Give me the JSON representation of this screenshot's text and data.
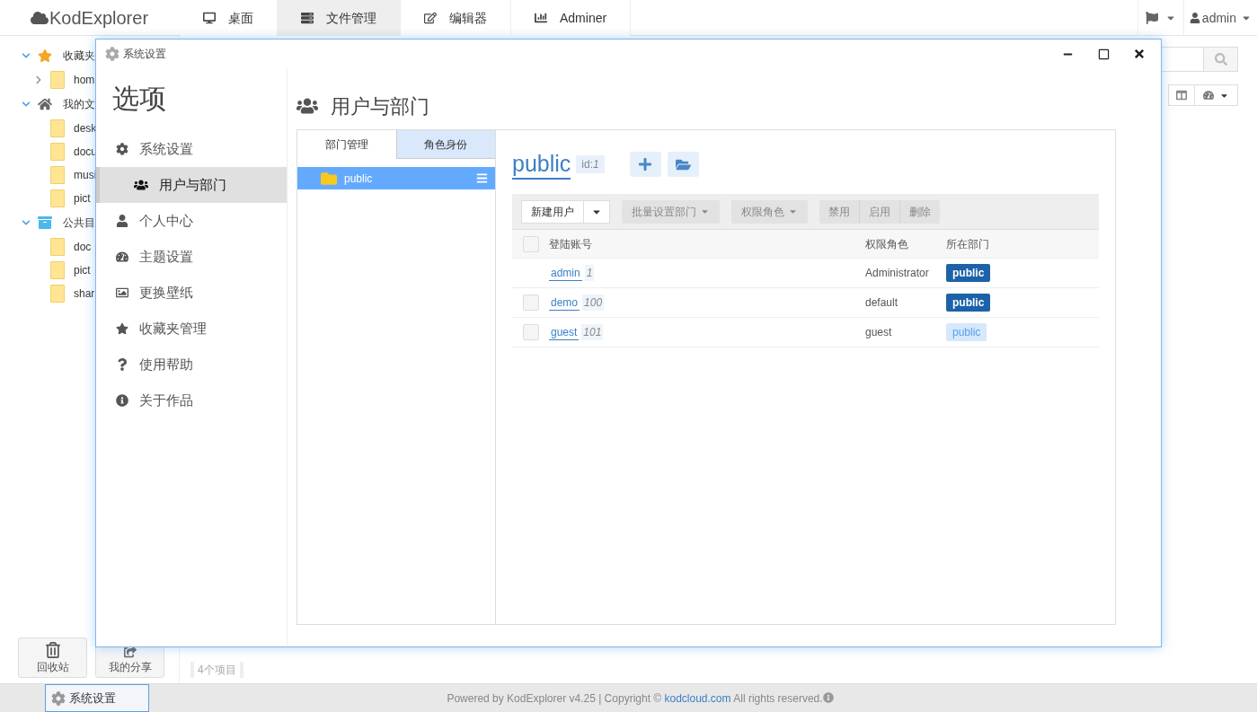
{
  "app": {
    "logo": "KodExplorer"
  },
  "nav_tabs": [
    {
      "label": "桌面",
      "selected": false
    },
    {
      "label": "文件管理",
      "selected": true
    },
    {
      "label": "编辑器",
      "selected": false
    },
    {
      "label": "Adminer",
      "selected": false
    }
  ],
  "user_menu": {
    "label": "admin"
  },
  "tree": [
    {
      "label": "收藏夹",
      "expanded": true,
      "children": [
        {
          "label": "hom",
          "expandable": true
        }
      ]
    },
    {
      "label": "我的文",
      "expanded": true,
      "children": [
        {
          "label": "desk",
          "expandable": false
        },
        {
          "label": "docu",
          "expandable": false
        },
        {
          "label": "musi",
          "expandable": false
        },
        {
          "label": "pict",
          "expandable": false
        }
      ]
    },
    {
      "label": "公共目",
      "expanded": true,
      "children": [
        {
          "label": "doc",
          "expandable": false
        },
        {
          "label": "pict",
          "expandable": false
        },
        {
          "label": "shar",
          "expandable": false
        }
      ]
    }
  ],
  "bottom_buttons": [
    {
      "label": "回收站"
    },
    {
      "label": "我的分享"
    }
  ],
  "status": {
    "count": "4个项目"
  },
  "footer": {
    "taskbar": [
      {
        "label": "系统设置",
        "selected": true
      }
    ],
    "credit": "Powered by KodExplorer v4.25 | Copyright © ",
    "link": "kodcloud.com",
    "suffix": " All rights reserved."
  },
  "dialog": {
    "title": "系统设置",
    "sidebar": {
      "heading": "选项",
      "items": [
        {
          "label": "系统设置",
          "selected": false,
          "children": [
            {
              "label": "用户与部门",
              "selected": true
            }
          ]
        },
        {
          "label": "个人中心",
          "selected": false
        },
        {
          "label": "主题设置",
          "selected": false
        },
        {
          "label": "更换壁纸",
          "selected": false
        },
        {
          "label": "收藏夹管理",
          "selected": false
        },
        {
          "label": "使用帮助",
          "selected": false
        },
        {
          "label": "关于作品",
          "selected": false
        }
      ]
    },
    "page_title": "用户与部门",
    "tabs": [
      {
        "label": "部门管理",
        "selected": true
      },
      {
        "label": "角色身份",
        "selected": false
      }
    ],
    "departments": [
      {
        "label": "public",
        "selected": true
      }
    ],
    "group": {
      "name": "public",
      "id": "id:*1*"
    },
    "toolbar": {
      "new_user": "新建用户",
      "dropdowns": [
        "批量设置部门",
        "权限角色"
      ],
      "actions": [
        "禁用",
        "启用",
        "删除"
      ]
    },
    "table": {
      "header_checked": false,
      "columns": [
        "登陆账号",
        "权限角色",
        "所在部门"
      ],
      "rows": [
        {
          "account": "admin",
          "uid": "1",
          "role": "Administrator",
          "department": "public",
          "color": "#1d62a8"
        },
        {
          "account": "demo",
          "uid": "100",
          "role": "default",
          "department": "public",
          "color": "#1d62a8",
          "checked": false
        },
        {
          "account": "guest",
          "uid": "101",
          "role": "guest",
          "department": "public",
          "color": "#d5e8fc",
          "checked": false
        }
      ]
    }
  }
}
